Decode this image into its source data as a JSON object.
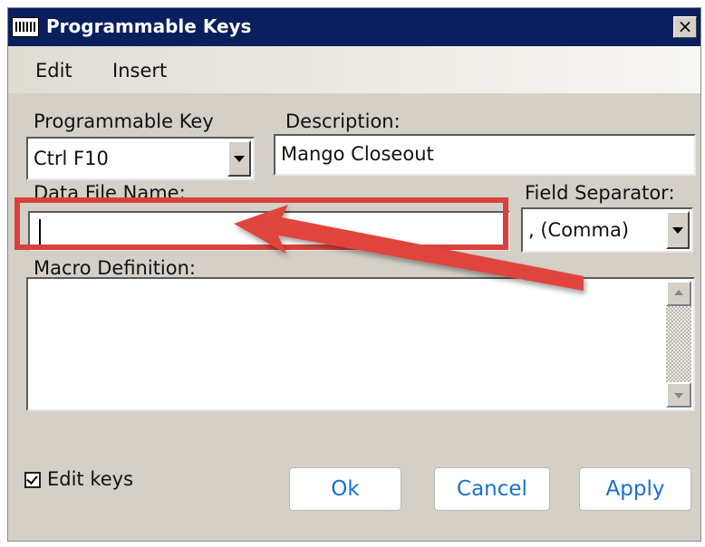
{
  "window": {
    "title": "Programmable Keys",
    "close_glyph": "×"
  },
  "menu": {
    "items": [
      {
        "label": "Edit"
      },
      {
        "label": "Insert"
      }
    ]
  },
  "form": {
    "programmable_key": {
      "label": "Programmable Key",
      "value": "Ctrl F10"
    },
    "description": {
      "label": "Description:",
      "value": "Mango Closeout"
    },
    "data_file_name": {
      "label": "Data File Name:",
      "value": ""
    },
    "field_separator": {
      "label": "Field Separator:",
      "value": ", (Comma)"
    },
    "macro_definition": {
      "label": "Macro Definition:",
      "value": ""
    }
  },
  "edit_keys": {
    "label": "Edit keys",
    "checked": true
  },
  "buttons": {
    "ok": "Ok",
    "cancel": "Cancel",
    "apply": "Apply"
  },
  "annotation": {
    "highlight_color": "#d9423a",
    "arrow_color": "#e0453c",
    "target": "Data File Name field"
  },
  "colors": {
    "titlebar": "#0a1f5e",
    "dialog_bg": "#d4d0c8",
    "button_text": "#1b6fd1"
  }
}
